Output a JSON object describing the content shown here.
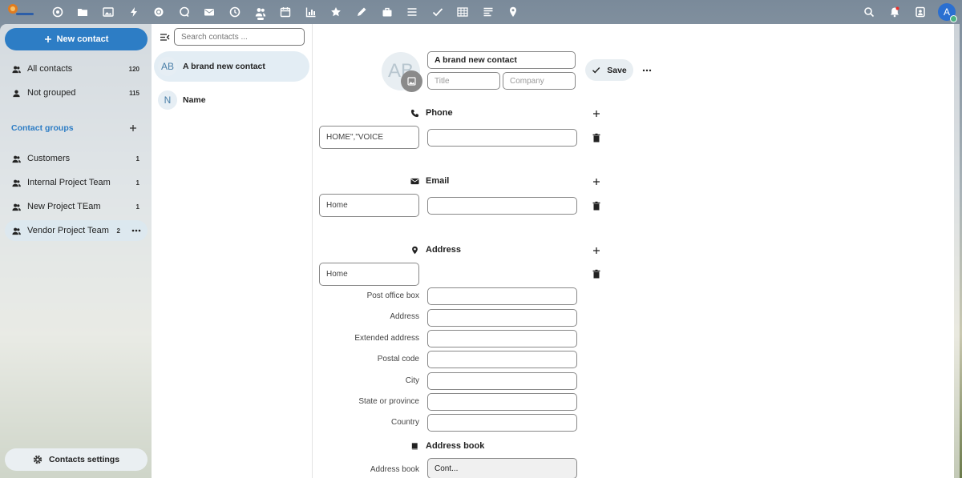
{
  "topbar": {
    "apps": [
      "dashboard-icon",
      "files-icon",
      "photos-icon",
      "activity-icon",
      "talk-icon",
      "chat-icon",
      "mail-icon",
      "clock-icon",
      "contacts-icon",
      "calendar-icon",
      "chart-icon",
      "star-icon",
      "pencil-icon",
      "briefcase-icon",
      "list-icon",
      "check-icon",
      "table-icon",
      "forms-icon",
      "maps-icon"
    ],
    "active_app": "contacts-icon",
    "user_initial": "A"
  },
  "nav": {
    "new_contact": "New contact",
    "items": [
      {
        "label": "All contacts",
        "count": "120"
      },
      {
        "label": "Not grouped",
        "count": "115"
      }
    ],
    "groups_heading": "Contact groups",
    "groups": [
      {
        "label": "Customers",
        "count": "1"
      },
      {
        "label": "Internal Project Team",
        "count": "1"
      },
      {
        "label": "New Project TEam",
        "count": "1"
      },
      {
        "label": "Vendor Project Team",
        "count": "2"
      }
    ],
    "settings": "Contacts settings"
  },
  "list": {
    "search_placeholder": "Search contacts ...",
    "contacts": [
      {
        "initials": "AB",
        "name": "A brand new contact"
      },
      {
        "initials": "N",
        "name": "Name"
      }
    ]
  },
  "detail": {
    "avatar_initials": "AB",
    "name_value": "A brand new contact",
    "title_placeholder": "Title",
    "company_placeholder": "Company",
    "save": "Save",
    "phone": {
      "title": "Phone",
      "type": "HOME\",\"VOICE"
    },
    "email": {
      "title": "Email",
      "type": "Home"
    },
    "address": {
      "title": "Address",
      "type": "Home",
      "labels": [
        "Post office box",
        "Address",
        "Extended address",
        "Postal code",
        "City",
        "State or province",
        "Country"
      ]
    },
    "address_book": {
      "title": "Address book",
      "label": "Address book",
      "value": "Cont..."
    }
  }
}
